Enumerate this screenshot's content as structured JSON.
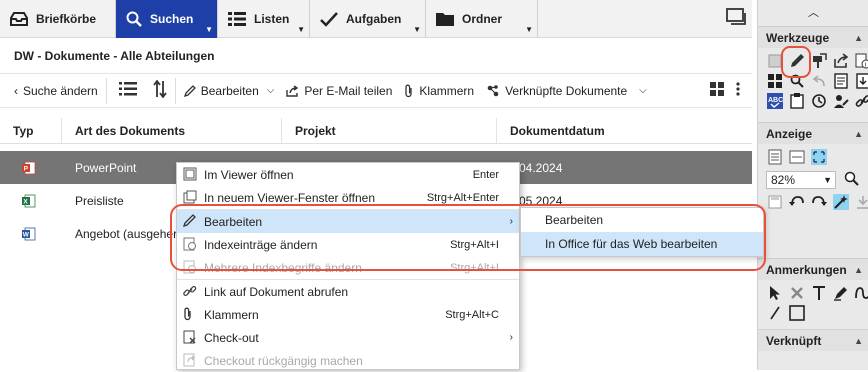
{
  "tabs": [
    {
      "label": "Briefkörbe",
      "icon": "inbox-icon"
    },
    {
      "label": "Suchen",
      "icon": "search-icon",
      "active": true
    },
    {
      "label": "Listen",
      "icon": "list-icon"
    },
    {
      "label": "Aufgaben",
      "icon": "check-icon"
    },
    {
      "label": "Ordner",
      "icon": "folder-icon"
    }
  ],
  "header": {
    "title": "DW - Dokumente - Alle Abteilungen"
  },
  "toolbar": {
    "back_label": "Suche ändern",
    "edit_label": "Bearbeiten",
    "email_label": "Per E-Mail teilen",
    "clip_label": "Klammern",
    "linked_label": "Verknüpfte Dokumente"
  },
  "columns": {
    "typ": "Typ",
    "art": "Art des Dokuments",
    "projekt": "Projekt",
    "datum": "Dokumentdatum"
  },
  "rows": [
    {
      "art": "PowerPoint",
      "datum": "04.2024",
      "icon": "powerpoint-file-icon"
    },
    {
      "art": "Preisliste",
      "datum": "05.2024",
      "icon": "excel-file-icon"
    },
    {
      "art": "Angebot (ausgeher",
      "datum": "",
      "icon": "word-file-icon"
    }
  ],
  "context_menu": [
    {
      "label": "Im Viewer öffnen",
      "shortcut": "Enter",
      "icon": "viewer-icon"
    },
    {
      "label": "In neuem Viewer-Fenster öffnen",
      "shortcut": "Strg+Alt+Enter",
      "icon": "new-window-icon"
    },
    {
      "label": "Bearbeiten",
      "shortcut": "",
      "icon": "pencil-icon",
      "highlighted": true,
      "submenu": true
    },
    {
      "label": "Indexeinträge ändern",
      "shortcut": "Strg+Alt+I",
      "icon": "index-icon"
    },
    {
      "label": "Mehrere Indexbegriffe ändern",
      "shortcut": "Strg+Alt+I",
      "icon": "multi-index-icon",
      "disabled": true
    },
    {
      "label": "Link auf Dokument abrufen",
      "shortcut": "",
      "icon": "link-icon"
    },
    {
      "label": "Klammern",
      "shortcut": "Strg+Alt+C",
      "icon": "paperclip-icon"
    },
    {
      "label": "Check-out",
      "shortcut": "",
      "icon": "checkout-icon",
      "submenu": true
    },
    {
      "label": "Checkout rückgängig machen",
      "shortcut": "",
      "icon": "undo-checkout-icon",
      "disabled": true
    }
  ],
  "submenu": [
    {
      "label": "Bearbeiten"
    },
    {
      "label": "In Office für das Web bearbeiten",
      "highlighted": true
    }
  ],
  "sidebar": {
    "tools_title": "Werkzeuge",
    "view_title": "Anzeige",
    "zoom_value": "82%",
    "annotations_title": "Anmerkungen",
    "linked_title": "Verknüpft"
  },
  "colors": {
    "accent": "#1f3fa8",
    "highlight": "#cfe5f9",
    "selected_row": "#757575",
    "callout": "#e8503e"
  }
}
